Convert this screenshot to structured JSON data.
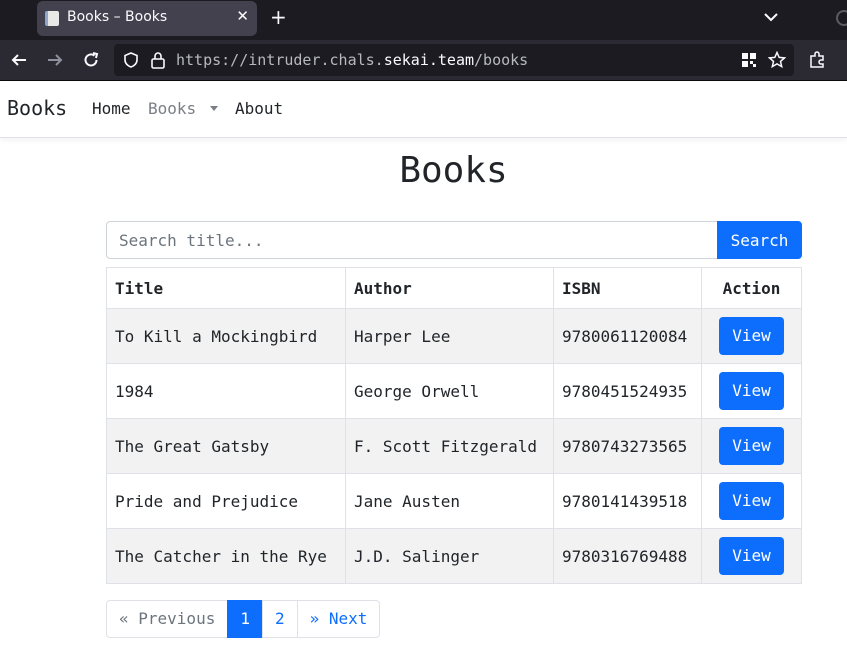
{
  "browser": {
    "tab_title": "Books – Books",
    "url_prefix": "https://intruder.chals.",
    "url_host": "sekai.team",
    "url_path": "/books"
  },
  "navbar": {
    "brand": "Books",
    "links": [
      "Home",
      "Books",
      "About"
    ]
  },
  "page": {
    "title": "Books",
    "search_placeholder": "Search title...",
    "search_button": "Search"
  },
  "table": {
    "headers": [
      "Title",
      "Author",
      "ISBN",
      "Action"
    ],
    "rows": [
      {
        "title": "To Kill a Mockingbird",
        "author": "Harper Lee",
        "isbn": "9780061120084",
        "action": "View"
      },
      {
        "title": "1984",
        "author": "George Orwell",
        "isbn": "9780451524935",
        "action": "View"
      },
      {
        "title": "The Great Gatsby",
        "author": "F. Scott Fitzgerald",
        "isbn": "9780743273565",
        "action": "View"
      },
      {
        "title": "Pride and Prejudice",
        "author": "Jane Austen",
        "isbn": "9780141439518",
        "action": "View"
      },
      {
        "title": "The Catcher in the Rye",
        "author": "J.D. Salinger",
        "isbn": "9780316769488",
        "action": "View"
      }
    ]
  },
  "pagination": {
    "previous": "« Previous",
    "pages": [
      "1",
      "2"
    ],
    "current": "1",
    "next": "» Next"
  },
  "colors": {
    "primary": "#0d6efd",
    "chrome_dark": "#1c1b22",
    "chrome_toolbar": "#2b2a33",
    "stripe": "#f2f2f2"
  }
}
